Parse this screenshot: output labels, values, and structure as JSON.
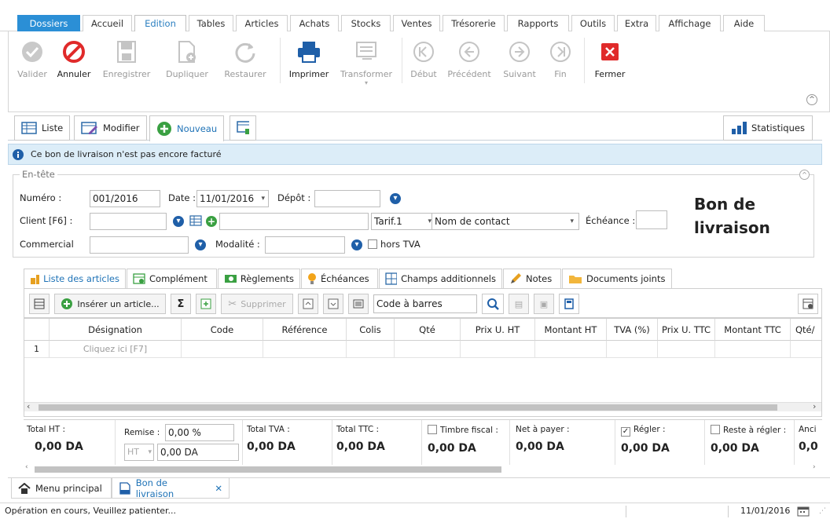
{
  "menu": {
    "tabs": [
      "Dossiers",
      "Accueil",
      "Edition",
      "Tables",
      "Articles",
      "Achats",
      "Stocks",
      "Ventes",
      "Trésorerie",
      "Rapports",
      "Outils",
      "Extra",
      "Affichage",
      "Aide"
    ],
    "active": "Edition"
  },
  "ribbon": {
    "buttons": [
      {
        "label": "Valider",
        "icon": "check-circle-icon",
        "enabled": false
      },
      {
        "label": "Annuler",
        "icon": "cancel-icon",
        "enabled": true
      },
      {
        "label": "Enregistrer",
        "icon": "save-icon",
        "enabled": false
      },
      {
        "label": "Dupliquer",
        "icon": "duplicate-icon",
        "enabled": false
      },
      {
        "label": "Restaurer",
        "icon": "restore-icon",
        "enabled": false
      },
      {
        "label": "Imprimer",
        "icon": "printer-icon",
        "enabled": true
      },
      {
        "label": "Transformer",
        "icon": "transform-icon",
        "enabled": false
      },
      {
        "label": "Début",
        "icon": "first-icon",
        "enabled": false
      },
      {
        "label": "Précédent",
        "icon": "previous-icon",
        "enabled": false
      },
      {
        "label": "Suivant",
        "icon": "next-icon",
        "enabled": false
      },
      {
        "label": "Fin",
        "icon": "last-icon",
        "enabled": false
      },
      {
        "label": "Fermer",
        "icon": "close-icon",
        "enabled": true
      }
    ]
  },
  "subtabs": {
    "liste": "Liste",
    "modifier": "Modifier",
    "nouveau": "Nouveau",
    "statistiques": "Statistiques"
  },
  "info": {
    "message": "Ce bon de livraison n'est pas encore facturé"
  },
  "header": {
    "legend": "En-tête",
    "numero_label": "Numéro :",
    "numero": "001/2016",
    "date_label": "Date :",
    "date": "11/01/2016",
    "depot_label": "Dépôt :",
    "client_label": "Client [F6] :",
    "tarif": "Tarif.1",
    "contact": "Nom de contact",
    "echeance_label": "Échéance :",
    "commercial_label": "Commercial",
    "modalite_label": "Modalité :",
    "hors_tva": "hors TVA",
    "doc_title": "Bon de livraison"
  },
  "tabs": [
    "Liste des articles",
    "Complément",
    "Règlements",
    "Échéances",
    "Champs additionnels",
    "Notes",
    "Documents joints"
  ],
  "grid_toolbar": {
    "inserer": "Insérer un article...",
    "supprimer": "Supprimer",
    "barcode_placeholder": "Code à barres"
  },
  "grid": {
    "columns": [
      "Désignation",
      "Code",
      "Référence",
      "Colis",
      "Qté",
      "Prix U. HT",
      "Montant HT",
      "TVA (%)",
      "Prix U. TTC",
      "Montant TTC",
      "Qté/"
    ],
    "rows": [
      {
        "num": "1",
        "designation": "Cliquez ici [F7]"
      }
    ]
  },
  "totals": {
    "total_ht_label": "Total HT :",
    "total_ht": "0,00 DA",
    "remise_label": "Remise :",
    "remise": "0,00 %",
    "remise_mode": "HT",
    "remise_amount": "0,00 DA",
    "total_tva_label": "Total TVA :",
    "total_tva": "0,00 DA",
    "total_ttc_label": "Total TTC :",
    "total_ttc": "0,00 DA",
    "timbre_label": "Timbre fiscal :",
    "timbre": "0,00 DA",
    "net_label": "Net à payer :",
    "net": "0,00 DA",
    "regler_label": "Régler :",
    "regler": "0,00 DA",
    "reste_label": "Reste à régler :",
    "reste": "0,00 DA",
    "anc_label": "Anci",
    "anc": "0,0"
  },
  "bottom_tabs": {
    "menu": "Menu principal",
    "doc": "Bon de livraison"
  },
  "status": {
    "message": "Opération en cours, Veuillez patienter...",
    "date": "11/01/2016"
  },
  "colors": {
    "accent": "#2b8fd6",
    "danger": "#e02a2a",
    "info_bg": "#dcedf8",
    "green": "#3aa042",
    "navy": "#1f5fa8"
  }
}
